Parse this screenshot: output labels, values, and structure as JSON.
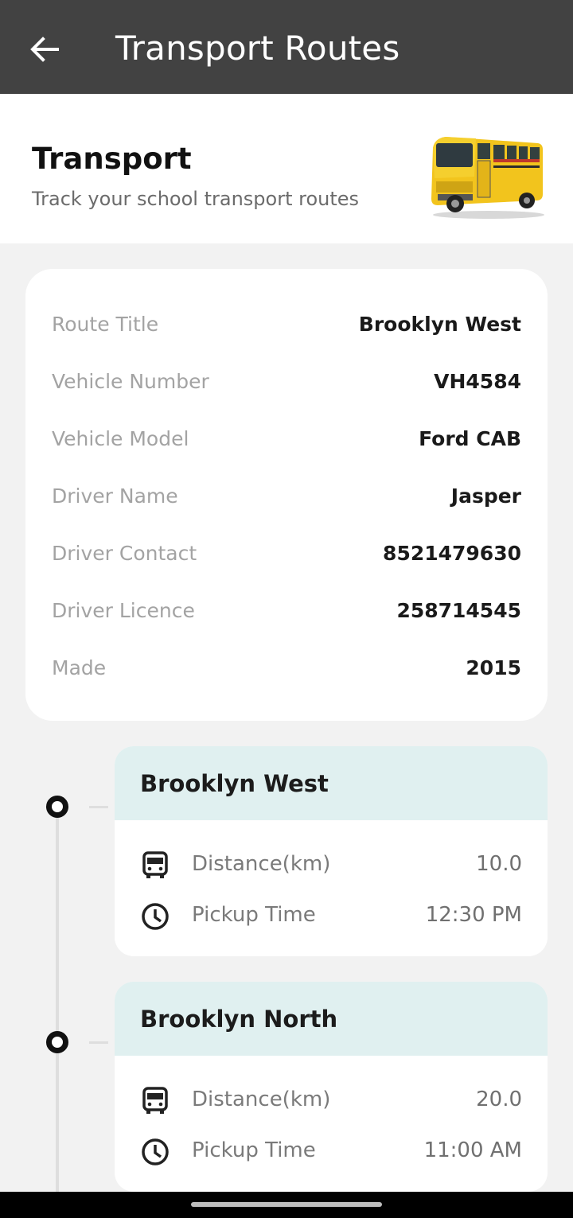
{
  "appbar": {
    "title": "Transport Routes"
  },
  "header": {
    "title": "Transport",
    "subtitle": "Track your school transport routes"
  },
  "details": [
    {
      "label": "Route Title",
      "value": "Brooklyn West"
    },
    {
      "label": "Vehicle Number",
      "value": "VH4584"
    },
    {
      "label": "Vehicle Model",
      "value": "Ford CAB"
    },
    {
      "label": "Driver Name",
      "value": "Jasper"
    },
    {
      "label": "Driver Contact",
      "value": "8521479630"
    },
    {
      "label": "Driver Licence",
      "value": "258714545"
    },
    {
      "label": "Made",
      "value": "2015"
    }
  ],
  "routes": [
    {
      "name": "Brooklyn West",
      "distance_label": "Distance(km)",
      "distance": "10.0",
      "pickup_label": "Pickup Time",
      "pickup": "12:30 PM"
    },
    {
      "name": "Brooklyn North",
      "distance_label": "Distance(km)",
      "distance": "20.0",
      "pickup_label": "Pickup Time",
      "pickup": "11:00 AM"
    }
  ],
  "icons": {
    "back": "arrow-left-icon",
    "distance": "bus-icon",
    "pickup": "clock-icon"
  },
  "colors": {
    "appbar": "#424242",
    "route_header": "#e0f0f0",
    "bus_yellow": "#f2c41d"
  }
}
